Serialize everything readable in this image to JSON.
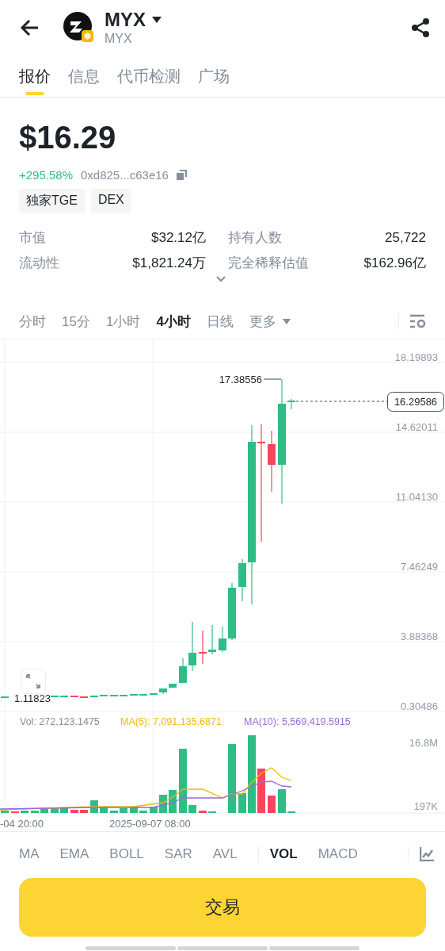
{
  "header": {
    "title": "MYX",
    "subtitle": "MYX"
  },
  "tabs": [
    {
      "label": "报价",
      "selected": true
    },
    {
      "label": "信息",
      "selected": false
    },
    {
      "label": "代币检测",
      "selected": false
    },
    {
      "label": "广场",
      "selected": false
    }
  ],
  "price": "$16.29",
  "change": "+295.58%",
  "contract": "0xd825...c63e16",
  "tags": [
    "独家TGE",
    "DEX"
  ],
  "stats": [
    {
      "label": "市值",
      "value": "$32.12亿"
    },
    {
      "label": "持有人数",
      "value": "25,722"
    },
    {
      "label": "流动性",
      "value": "$1,821.24万"
    },
    {
      "label": "完全稀释估值",
      "value": "$162.96亿"
    }
  ],
  "intervals": [
    {
      "label": "分时",
      "selected": false,
      "kind": "plain"
    },
    {
      "label": "15分",
      "selected": false,
      "kind": "plain"
    },
    {
      "label": "1小时",
      "selected": false,
      "kind": "plain"
    },
    {
      "label": "4小时",
      "selected": true,
      "kind": "plain"
    },
    {
      "label": "日线",
      "selected": false,
      "kind": "plain"
    },
    {
      "label": "更多",
      "selected": false,
      "kind": "menu"
    }
  ],
  "chart": {
    "price_ticks": [
      "18.19893",
      "14.62011",
      "11.04130",
      "7.46249",
      "3.88368",
      "0.30486"
    ],
    "high_label": "17.38556",
    "last_price": "16.29586",
    "low_label": "1.11823",
    "volume_legend": {
      "vol": "Vol: 272,123.1475",
      "ma5": "MA(5): 7,091,135.6871",
      "ma10": "MA(10): 5,569,419.5915"
    },
    "volume_ticks": [
      "16.8M",
      "197K"
    ],
    "time_labels": [
      "-04 20:00",
      "2025-09-07 08:00"
    ]
  },
  "indicators": [
    {
      "label": "MA",
      "selected": false,
      "kind": "main"
    },
    {
      "label": "EMA",
      "selected": false,
      "kind": "main"
    },
    {
      "label": "BOLL",
      "selected": false,
      "kind": "main"
    },
    {
      "label": "SAR",
      "selected": false,
      "kind": "main"
    },
    {
      "label": "AVL",
      "selected": false,
      "kind": "main"
    },
    {
      "label": "VOL",
      "selected": true,
      "kind": "sub"
    },
    {
      "label": "MACD",
      "selected": false,
      "kind": "sub"
    }
  ],
  "trade_button": "交易"
}
